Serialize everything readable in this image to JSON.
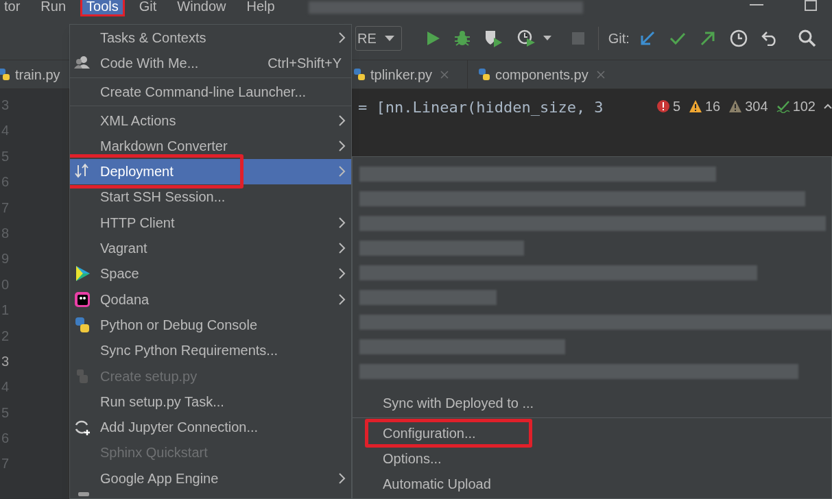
{
  "menu_bar": [
    {
      "label": "tor",
      "selected": false
    },
    {
      "label": "Run",
      "selected": false
    },
    {
      "label": "Tools",
      "selected": true
    },
    {
      "label": "Git",
      "selected": false
    },
    {
      "label": "Window",
      "selected": false
    },
    {
      "label": "Help",
      "selected": false
    }
  ],
  "toolbar": {
    "run_config": "RE",
    "git_label": "Git:"
  },
  "editor_tabs": [
    {
      "label": "train.py"
    },
    {
      "label": "tplinker.py",
      "closable": true
    },
    {
      "label": "components.py",
      "closable": true
    }
  ],
  "line_numbers": [
    "3",
    "4",
    "5",
    "6",
    "7",
    "8",
    "9",
    "0",
    "1",
    "2",
    "3",
    "4",
    "5",
    "6",
    "7"
  ],
  "code_lines": [
    "= [nn.Linear(hidden_size, 3"
  ],
  "inspections": [
    {
      "kind": "error",
      "count": "5"
    },
    {
      "kind": "warning",
      "count": "16"
    },
    {
      "kind": "weak",
      "count": "304"
    },
    {
      "kind": "typo",
      "count": "102"
    }
  ],
  "tools_menu": [
    {
      "kind": "plain",
      "label": "Tasks & Contexts",
      "submenu": true,
      "disabled": false,
      "selected": false
    },
    {
      "kind": "people",
      "label": "Code With Me...",
      "shortcut": "Ctrl+Shift+Y",
      "submenu": false,
      "disabled": false,
      "selected": false
    },
    {
      "kind": "separator"
    },
    {
      "kind": "plain",
      "label": "Create Command-line Launcher...",
      "submenu": false,
      "disabled": false,
      "selected": false
    },
    {
      "kind": "separator"
    },
    {
      "kind": "plain",
      "label": "XML Actions",
      "submenu": true,
      "disabled": false,
      "selected": false
    },
    {
      "kind": "plain",
      "label": "Markdown Converter",
      "submenu": true,
      "disabled": false,
      "selected": false
    },
    {
      "kind": "deploy",
      "label": "Deployment",
      "submenu": true,
      "disabled": false,
      "selected": true
    },
    {
      "kind": "plain",
      "label": "Start SSH Session...",
      "submenu": false,
      "disabled": false,
      "selected": false
    },
    {
      "kind": "plain",
      "label": "HTTP Client",
      "submenu": true,
      "disabled": false,
      "selected": false
    },
    {
      "kind": "plain",
      "label": "Vagrant",
      "submenu": true,
      "disabled": false,
      "selected": false
    },
    {
      "kind": "space",
      "label": "Space",
      "submenu": true,
      "disabled": false,
      "selected": false
    },
    {
      "kind": "qodana",
      "label": "Qodana",
      "submenu": true,
      "disabled": false,
      "selected": false
    },
    {
      "kind": "python",
      "label": "Python or Debug Console",
      "submenu": false,
      "disabled": false,
      "selected": false
    },
    {
      "kind": "plain",
      "label": "Sync Python Requirements...",
      "submenu": false,
      "disabled": false,
      "selected": false
    },
    {
      "kind": "setup",
      "label": "Create setup.py",
      "submenu": false,
      "disabled": true,
      "selected": false
    },
    {
      "kind": "plain",
      "label": "Run setup.py Task...",
      "submenu": false,
      "disabled": false,
      "selected": false
    },
    {
      "kind": "jupyter",
      "label": "Add Jupyter Connection...",
      "submenu": false,
      "disabled": false,
      "selected": false
    },
    {
      "kind": "plain",
      "label": "Sphinx Quickstart",
      "submenu": false,
      "disabled": true,
      "selected": false
    },
    {
      "kind": "plain",
      "label": "Google App Engine",
      "submenu": true,
      "disabled": false,
      "selected": false
    }
  ],
  "deployment_submenu": [
    {
      "kind": "item",
      "label": "Sync with Deployed to ...",
      "highlighted": false
    },
    {
      "kind": "separator"
    },
    {
      "kind": "item",
      "label": "Configuration...",
      "highlighted": true
    },
    {
      "kind": "item",
      "label": "Options...",
      "highlighted": false
    },
    {
      "kind": "item",
      "label": "Automatic Upload",
      "highlighted": false
    }
  ]
}
